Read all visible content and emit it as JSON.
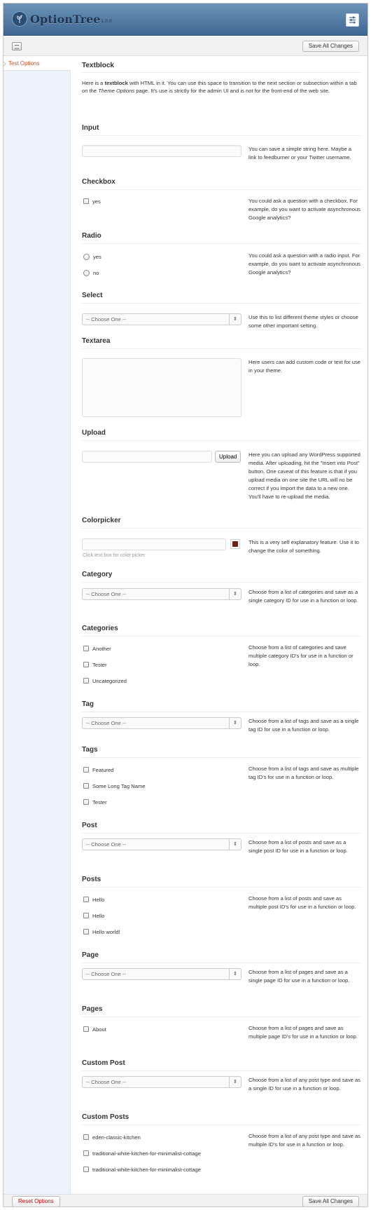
{
  "app": {
    "logo_text": "OptionTree",
    "version": "1.0.0"
  },
  "toolbar": {
    "save_label": "Save All Changes"
  },
  "sidebar": {
    "items": [
      {
        "label": "Test Options"
      }
    ]
  },
  "textblock": {
    "title": "Textblock",
    "text_before": "Here is a ",
    "text_bold": "textblock",
    "text_mid": " with HTML in it. You can use this space to transition to the next section or subsection within a tab on the ",
    "text_em": "Theme Options",
    "text_after": " page. It's use is strictly for the admin UI and is not for the front-end of the web site."
  },
  "input": {
    "title": "Input",
    "value": "",
    "desc": "You can save a simple string here. Maybe a link to feedburner or your Twitter username."
  },
  "checkbox": {
    "title": "Checkbox",
    "options": [
      "yes"
    ],
    "desc": "You could ask a question with a checkbox. For example, do you want to activate asynchronous Google analytics?"
  },
  "radio": {
    "title": "Radio",
    "options": [
      "yes",
      "no"
    ],
    "desc": "You could ask a question with a radio input. For example, do you want to activate asynchronous Google analytics?"
  },
  "select": {
    "title": "Select",
    "value": "-- Choose One --",
    "desc": "Use this to list different theme styles or choose some other important setting."
  },
  "textarea": {
    "title": "Textarea",
    "value": "",
    "desc": "Here users can add custom code or text for use in your theme."
  },
  "upload": {
    "title": "Upload",
    "button": "Upload",
    "value": "",
    "desc": "Here you can upload any WordPress supported media. After uploading, hit the \"Insert into Post\" button. One caveat of this feature is that if you upload media on one site the URL will no be correct if you import the data to a new one. You'll have to re-upload the media."
  },
  "colorpicker": {
    "title": "Colorpicker",
    "hint": "Click text box for color picker",
    "swatch_color": "#6b1f1f",
    "desc": "This is a very self explanatory feature. Use it to change the color of something."
  },
  "category": {
    "title": "Category",
    "value": "-- Choose One --",
    "desc": "Choose from a list of categories and save as a single category ID for use in a function or loop."
  },
  "categories": {
    "title": "Categories",
    "options": [
      "Another",
      "Tester",
      "Uncategorized"
    ],
    "desc": "Choose from a list of categories and save multiple category ID's for use in a function or loop."
  },
  "tag": {
    "title": "Tag",
    "value": "-- Choose One --",
    "desc": "Choose from a list of tags and save as a single tag ID for use in a function or loop."
  },
  "tags": {
    "title": "Tags",
    "options": [
      "Featured",
      "Some Long Tag Name",
      "Tester"
    ],
    "desc": "Choose from a list of tags and save as multiple tag ID's for use in a function or loop."
  },
  "post": {
    "title": "Post",
    "value": "-- Choose One --",
    "desc": "Choose from a list of posts and save as a single post ID for use in a function or loop."
  },
  "posts": {
    "title": "Posts",
    "options": [
      "Hello",
      "Hello",
      "Hello world!"
    ],
    "desc": "Choose from a list of posts and save as multiple post ID's for use in a function or loop."
  },
  "page": {
    "title": "Page",
    "value": "-- Choose One --",
    "desc": "Choose from a list of pages and save as a single page ID for use in a function or loop."
  },
  "pages": {
    "title": "Pages",
    "options": [
      "About"
    ],
    "desc": "Choose from a list of pages and save as multiple page ID's for use in a function or loop."
  },
  "custom_post": {
    "title": "Custom Post",
    "value": "-- Choose One --",
    "desc": "Choose from a list of any post type and save as a single ID for use in a function or loop."
  },
  "custom_posts": {
    "title": "Custom Posts",
    "options": [
      "eden-classic-kitchen",
      "traditional-white-kitchen-for-minimalist-cottage",
      "traditional-white-kitchen-for-minimalist-cottage"
    ],
    "desc": "Choose from a list of any post type and save as multiple ID's for use in a function or loop."
  },
  "footer": {
    "reset_label": "Reset Options",
    "save_label": "Save All Changes"
  }
}
